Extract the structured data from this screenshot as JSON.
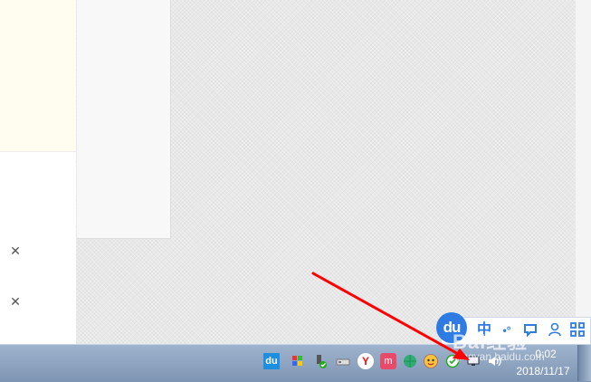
{
  "left_pane": {
    "close_glyph": "✕"
  },
  "ime": {
    "logo": "du",
    "mode_label": "中",
    "punct": "•°",
    "skin_icon": "shirt-icon",
    "user_icon": "user-icon",
    "grid_icon": "grid-icon",
    "accent": "#2e7be3"
  },
  "tray": {
    "icons": [
      "baidu-du-icon",
      "flag-icon",
      "usb-safe-remove-icon",
      "drive-icon",
      "yandex-y-icon",
      "app-m-icon",
      "network-globe-icon",
      "qq-face-icon",
      "shield-check-icon",
      "display-icon",
      "volume-icon"
    ],
    "baidu_label": "du",
    "yandex_label": "Y",
    "app_m_label": "m"
  },
  "clock": {
    "time": "0:02",
    "date": "2018/11/17"
  },
  "watermark": {
    "brand": "Bai经验",
    "url": "jingyan.baidu.com"
  },
  "annotation": {
    "arrow_color": "#ff0000"
  }
}
